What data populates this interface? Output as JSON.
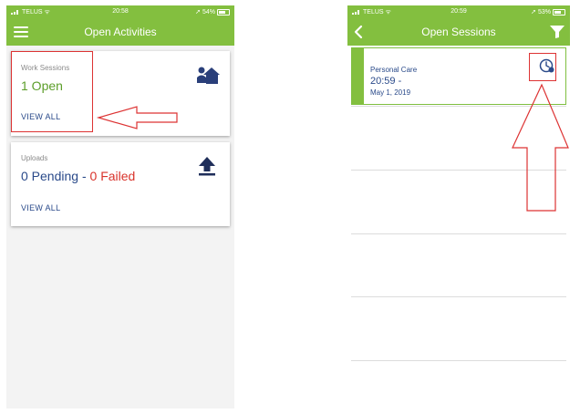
{
  "left": {
    "status": {
      "carrier": "TELUS",
      "time": "20:58",
      "battery": "54%"
    },
    "header": {
      "title": "Open Activities"
    },
    "work_sessions": {
      "label": "Work Sessions",
      "value": "1 Open",
      "link": "VIEW ALL"
    },
    "uploads": {
      "label": "Uploads",
      "pending": "0 Pending",
      "separator": " - ",
      "failed": "0 Failed",
      "link": "VIEW ALL"
    }
  },
  "right": {
    "status": {
      "carrier": "TELUS",
      "time": "20:59",
      "battery": "53%"
    },
    "header": {
      "title": "Open Sessions"
    },
    "session": {
      "type": "Personal Care",
      "time": "20:59 -",
      "date": "May 1, 2019"
    }
  },
  "colors": {
    "header": "#83bf3f",
    "accent_green": "#5c9e2a",
    "navy": "#2a4a8a",
    "failed_red": "#d9332b",
    "annotation": "#dd3333"
  },
  "icons": [
    "menu-icon",
    "home-icon",
    "upload-icon",
    "back-icon",
    "filter-icon",
    "clock-icon"
  ]
}
